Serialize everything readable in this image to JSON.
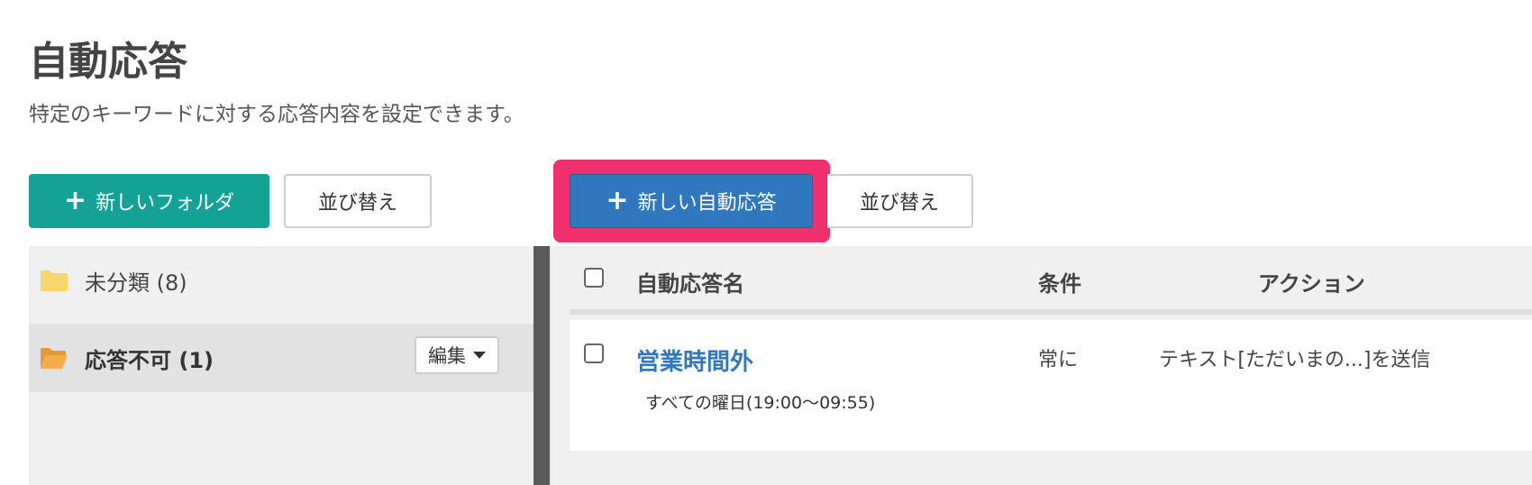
{
  "page": {
    "title": "自動応答",
    "subtitle": "特定のキーワードに対する応答内容を設定できます。"
  },
  "toolbar": {
    "new_folder_label": "新しいフォルダ",
    "sort_folders_label": "並び替え",
    "new_autoresponse_label": "新しい自動応答",
    "sort_autoresponses_label": "並び替え",
    "plus_glyph": "+"
  },
  "folders": {
    "items": [
      {
        "label": "未分類 (8)",
        "icon": "folder-closed-icon"
      },
      {
        "label": "応答不可 (1)",
        "icon": "folder-open-icon",
        "selected": true,
        "edit_label": "編集"
      }
    ]
  },
  "table": {
    "headers": {
      "name": "自動応答名",
      "condition": "条件",
      "action": "アクション"
    },
    "rows": [
      {
        "name": "営業時間外",
        "schedule": "すべての曜日(19:00〜09:55)",
        "condition": "常に",
        "action": "テキスト[ただいまの...]を送信"
      }
    ]
  },
  "colors": {
    "green_button": "#14a295",
    "blue_button": "#2f78bd",
    "highlight": "#f2306f",
    "folder_yellow": "#f9d66b",
    "folder_open": "#f4ad4b",
    "link": "#2f78bd"
  }
}
